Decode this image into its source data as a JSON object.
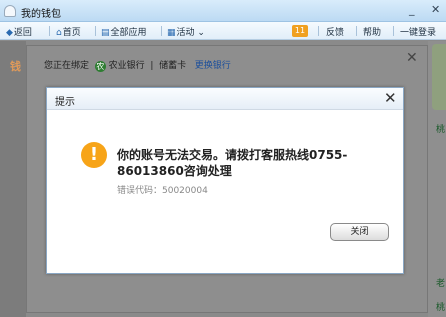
{
  "window": {
    "title": "我的钱包",
    "minimize": "_",
    "close": "✕"
  },
  "toolbar": {
    "back": "返回",
    "home": "首页",
    "all_apps": "全部应用",
    "activity": "活动",
    "notification_count": "11",
    "feedback": "反馈",
    "help": "帮助",
    "one_click_login": "一键登录"
  },
  "background": {
    "logo_char": "钱",
    "binding_prefix": "您正在绑定",
    "bank_name": "农业银行",
    "card_type": "储蓄卡",
    "change_bank": "更换银行",
    "close": "✕"
  },
  "sidebar_right": {
    "text_1": "桃",
    "text_2": "老",
    "text_3": "桃"
  },
  "dialog": {
    "title": "提示",
    "close": "✕",
    "message": "你的账号无法交易。请拨打客服热线0755-86013860咨询处理",
    "error_code": "错误代码：50020004",
    "close_button": "关闭"
  },
  "colors": {
    "warning": "#f7a418",
    "link": "#1c4f9c",
    "bank_green": "#2e7d32"
  }
}
